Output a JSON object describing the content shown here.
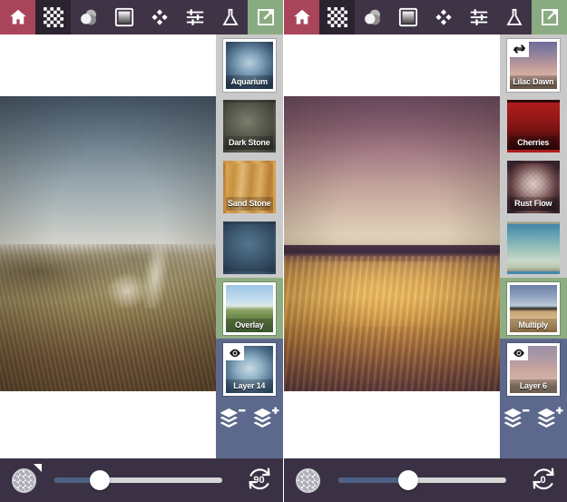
{
  "app": {
    "name": "photo-layer-editor",
    "colors": {
      "toolbar_bg": "#3e3446",
      "home_accent": "#a9455a",
      "export_accent": "#8aab82",
      "panel_bg": "#c9c9c9",
      "selected_band": "#8fad83",
      "layers_band": "#5d698c",
      "bottombar_bg": "#3a3244",
      "slider_fill": "#4e6185"
    }
  },
  "toolbar": {
    "items": [
      {
        "name": "home-button",
        "icon": "home-icon",
        "label": "Home"
      },
      {
        "name": "texture-button",
        "icon": "checkerboard-icon",
        "label": "Textures"
      },
      {
        "name": "blend-button",
        "icon": "blend-circles-icon",
        "label": "Blend"
      },
      {
        "name": "gradient-button",
        "icon": "gradient-square-icon",
        "label": "Gradient"
      },
      {
        "name": "shape-button",
        "icon": "diamond-cluster-icon",
        "label": "Shapes"
      },
      {
        "name": "adjust-button",
        "icon": "sliders-icon",
        "label": "Adjust"
      },
      {
        "name": "effects-button",
        "icon": "flask-icon",
        "label": "Effects"
      },
      {
        "name": "export-button",
        "icon": "export-arrow-icon",
        "label": "Export"
      }
    ]
  },
  "panes": [
    {
      "id": "left",
      "canvas": {
        "name": "dune-landscape-photo",
        "alt": "Coastal dune landscape with grass and sandy path under a blue-grey sky"
      },
      "panel": {
        "presets": [
          {
            "label": "Aquarium",
            "selected": true,
            "texture": "t-aquarium",
            "badge": "none"
          },
          {
            "label": "Dark Stone",
            "selected": false,
            "texture": "t-darkstone",
            "badge": "none"
          },
          {
            "label": "Sand Stone",
            "selected": false,
            "texture": "t-sandstone",
            "badge": "none"
          },
          {
            "label": "",
            "selected": false,
            "texture": "t-bluestone",
            "badge": "none"
          }
        ],
        "blend_mode": {
          "label": "Overlay",
          "selected": true,
          "texture": "t-overlay",
          "badge": "none"
        },
        "layer": {
          "label": "Layer 14",
          "selected": true,
          "texture": "t-layer14",
          "badge": "eye"
        },
        "layer_buttons": [
          {
            "name": "remove-layer-button",
            "icon": "layers-minus-icon",
            "label": "Remove layer"
          },
          {
            "name": "add-layer-button",
            "icon": "layers-plus-icon",
            "label": "Add layer"
          }
        ]
      },
      "bottombar": {
        "swatch": {
          "name": "color-swatch",
          "pattern": "checker",
          "has_corner_marker": true
        },
        "slider": {
          "name": "opacity-slider",
          "value": 27,
          "min": 0,
          "max": 100
        },
        "rotate": {
          "name": "rotate-button",
          "icon": "rotate-icon",
          "value": "90"
        }
      }
    },
    {
      "id": "right",
      "canvas": {
        "name": "field-landscape-photo",
        "alt": "Harvested field at sunset with purple sky and golden stubble"
      },
      "panel": {
        "presets": [
          {
            "label": "Lilac Dawn",
            "selected": true,
            "texture": "t-lilac",
            "badge": "swap"
          },
          {
            "label": "Cherries",
            "selected": false,
            "texture": "t-cherries",
            "badge": "none"
          },
          {
            "label": "Rust Flow",
            "selected": false,
            "texture": "t-rustflow",
            "badge": "none"
          },
          {
            "label": "",
            "selected": false,
            "texture": "t-tealgrad",
            "badge": "none"
          }
        ],
        "blend_mode": {
          "label": "Multiply",
          "selected": true,
          "texture": "t-multiply",
          "badge": "none"
        },
        "layer": {
          "label": "Layer 6",
          "selected": true,
          "texture": "t-layer6",
          "badge": "eye"
        },
        "layer_buttons": [
          {
            "name": "remove-layer-button",
            "icon": "layers-minus-icon",
            "label": "Remove layer"
          },
          {
            "name": "add-layer-button",
            "icon": "layers-plus-icon",
            "label": "Add layer"
          }
        ]
      },
      "bottombar": {
        "swatch": {
          "name": "color-swatch",
          "pattern": "checker",
          "has_corner_marker": false
        },
        "slider": {
          "name": "opacity-slider",
          "value": 42,
          "min": 0,
          "max": 100
        },
        "rotate": {
          "name": "rotate-button",
          "icon": "rotate-icon",
          "value": "0"
        }
      }
    }
  ]
}
